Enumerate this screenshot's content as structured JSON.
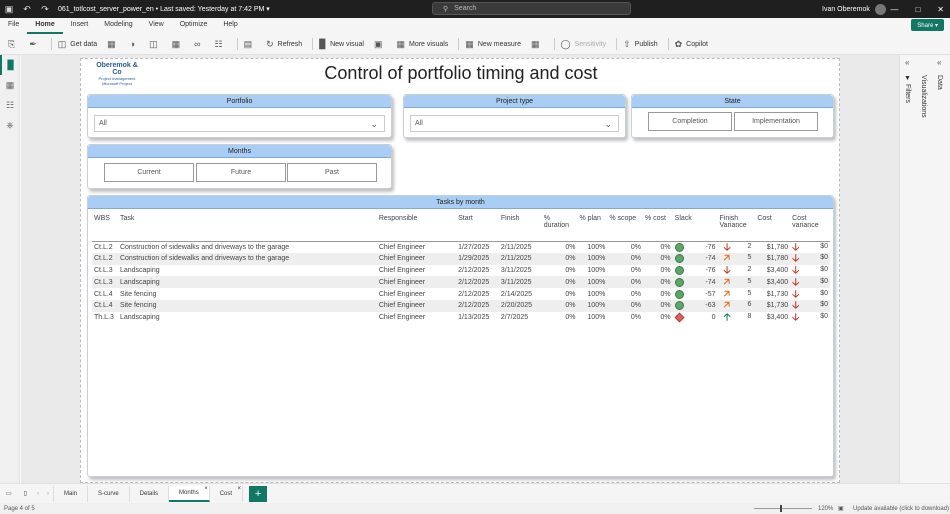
{
  "titlebar": {
    "filename": "061_totlcost_server_power_en • Last saved: Yesterday at 7:42 PM ▾",
    "search_placeholder": "Search",
    "user": "Ivan Oberemok"
  },
  "menu": [
    "File",
    "Home",
    "Insert",
    "Modeling",
    "View",
    "Optimize",
    "Help"
  ],
  "share": "Share ▾",
  "toolbar": {
    "get_data": "Get data",
    "refresh": "Refresh",
    "new_visual": "New visual",
    "more_visuals": "More visuals",
    "new_measure": "New measure",
    "sensitivity": "Sensitivity",
    "publish": "Publish",
    "copilot": "Copilot"
  },
  "logo": {
    "name": "Oberemok & Co",
    "line1": "Project management",
    "line2": "Microsoft Project"
  },
  "report_title": "Control of portfolio timing and cost",
  "portfolio": {
    "header": "Portfolio",
    "value": "All"
  },
  "project_type": {
    "header": "Project type",
    "value": "All"
  },
  "state": {
    "header": "State",
    "options": [
      "Completion",
      "Implementation"
    ]
  },
  "months": {
    "header": "Months",
    "options": [
      "Current",
      "Future",
      "Past"
    ]
  },
  "tasks": {
    "header": "Tasks by month",
    "columns": [
      "WBS",
      "Task",
      "Responsible",
      "Start",
      "Finish",
      "% duration",
      "% plan",
      "% scope",
      "% cost",
      "Slack",
      "",
      "Finish Variance",
      "Cost",
      "Cost variance"
    ],
    "rows": [
      {
        "wbs": "Ct.L.2",
        "task": "Construction of sidewalks and driveways to the garage",
        "resp": "Chief Engineer",
        "start": "1/27/2025",
        "finish": "2/11/2025",
        "dur": "0%",
        "plan": "100%",
        "scope": "0%",
        "cost_pct": "0%",
        "status": "ok",
        "slack": "-76",
        "arrow": "down",
        "fv": "2",
        "cost": "$1,780",
        "arrow2": "down",
        "cv": "$0"
      },
      {
        "wbs": "Ct.L.2",
        "task": "Construction of sidewalks and driveways to the garage",
        "resp": "Chief Engineer",
        "start": "1/29/2025",
        "finish": "2/11/2025",
        "dur": "0%",
        "plan": "100%",
        "scope": "0%",
        "cost_pct": "0%",
        "status": "ok",
        "slack": "-74",
        "arrow": "upright",
        "fv": "5",
        "cost": "$1,780",
        "arrow2": "down",
        "cv": "$0"
      },
      {
        "wbs": "Ct.L.3",
        "task": "Landscaping",
        "resp": "Chief Engineer",
        "start": "2/12/2025",
        "finish": "3/11/2025",
        "dur": "0%",
        "plan": "100%",
        "scope": "0%",
        "cost_pct": "0%",
        "status": "ok",
        "slack": "-76",
        "arrow": "down",
        "fv": "2",
        "cost": "$3,400",
        "arrow2": "down",
        "cv": "$0"
      },
      {
        "wbs": "Ct.L.3",
        "task": "Landscaping",
        "resp": "Chief Engineer",
        "start": "2/12/2025",
        "finish": "3/11/2025",
        "dur": "0%",
        "plan": "100%",
        "scope": "0%",
        "cost_pct": "0%",
        "status": "ok",
        "slack": "-74",
        "arrow": "upright",
        "fv": "5",
        "cost": "$3,400",
        "arrow2": "down",
        "cv": "$0"
      },
      {
        "wbs": "Ct.L.4",
        "task": "Site fencing",
        "resp": "Chief Engineer",
        "start": "2/12/2025",
        "finish": "2/14/2025",
        "dur": "0%",
        "plan": "100%",
        "scope": "0%",
        "cost_pct": "0%",
        "status": "ok",
        "slack": "-57",
        "arrow": "upright",
        "fv": "5",
        "cost": "$1,730",
        "arrow2": "down",
        "cv": "$0"
      },
      {
        "wbs": "Ct.L.4",
        "task": "Site fencing",
        "resp": "Chief Engineer",
        "start": "2/12/2025",
        "finish": "2/20/2025",
        "dur": "0%",
        "plan": "100%",
        "scope": "0%",
        "cost_pct": "0%",
        "status": "ok",
        "slack": "-63",
        "arrow": "upright",
        "fv": "6",
        "cost": "$1,730",
        "arrow2": "down",
        "cv": "$0"
      },
      {
        "wbs": "Th.L.3",
        "task": "Landscaping",
        "resp": "Chief Engineer",
        "start": "1/13/2025",
        "finish": "2/7/2025",
        "dur": "0%",
        "plan": "100%",
        "scope": "0%",
        "cost_pct": "0%",
        "status": "bad",
        "slack": "0",
        "arrow": "up",
        "fv": "8",
        "cost": "$3,400",
        "arrow2": "down",
        "cv": "$0"
      }
    ]
  },
  "right_pane": {
    "filters": "Filters",
    "visualizations": "Visualizations",
    "data": "Data"
  },
  "tabs": [
    "Main",
    "S-curve",
    "Details",
    "Months",
    "Cost"
  ],
  "status": {
    "page": "Page 4 of 5",
    "zoom": "120%",
    "update": "Update available (click to download)"
  },
  "colors": {
    "accent": "#117865",
    "header_blue": "#a9cdf5",
    "ok_green": "#5da66a",
    "bad_red": "#e06060"
  }
}
